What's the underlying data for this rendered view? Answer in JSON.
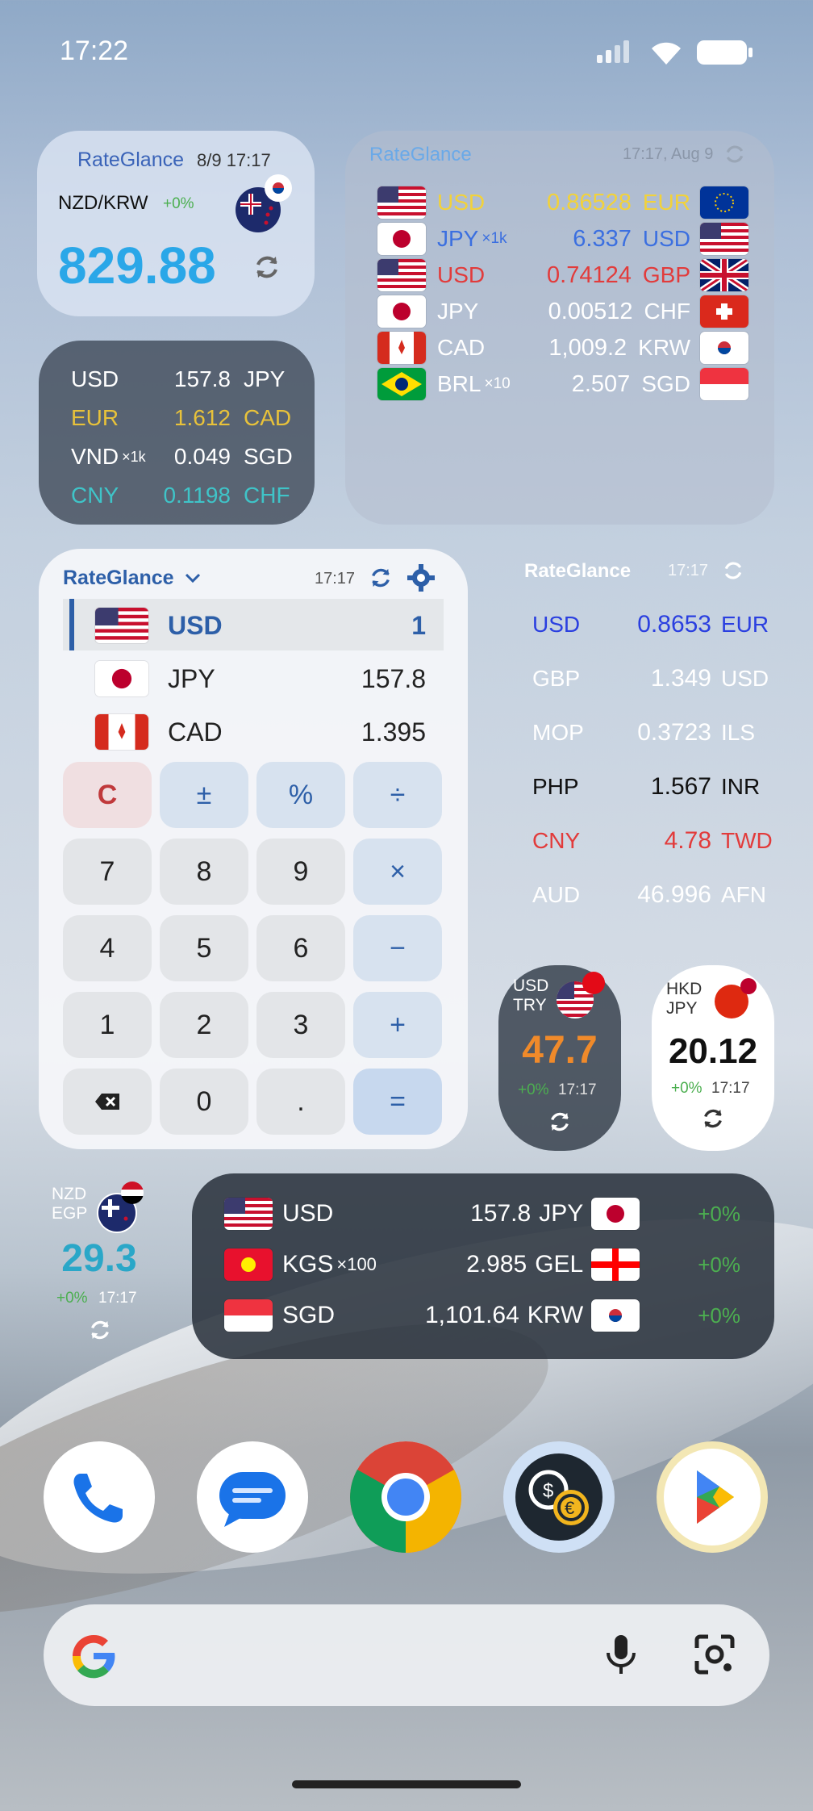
{
  "status": {
    "time": "17:22"
  },
  "w1": {
    "app": "RateGlance",
    "datetime": "8/9 17:17",
    "pair": "NZD/KRW",
    "change": "+0%",
    "rate": "829.88"
  },
  "w2": {
    "app": "RateGlance",
    "datetime": "17:17, Aug 9",
    "rows": [
      {
        "from": "USD",
        "mult": "",
        "rate": "0.86528",
        "to": "EUR",
        "color": "#f2d23a"
      },
      {
        "from": "JPY",
        "mult": "×1k",
        "rate": "6.337",
        "to": "USD",
        "color": "#3b6fe0"
      },
      {
        "from": "USD",
        "mult": "",
        "rate": "0.74124",
        "to": "GBP",
        "color": "#e23b3b"
      },
      {
        "from": "JPY",
        "mult": "",
        "rate": "0.00512",
        "to": "CHF",
        "color": "#ffffff"
      },
      {
        "from": "CAD",
        "mult": "",
        "rate": "1,009.2",
        "to": "KRW",
        "color": "#ffffff"
      },
      {
        "from": "BRL",
        "mult": "×10",
        "rate": "2.507",
        "to": "SGD",
        "color": "#ffffff"
      }
    ]
  },
  "w3": {
    "rows": [
      {
        "from": "USD",
        "mult": "",
        "rate": "157.8",
        "to": "JPY",
        "color": "#ffffff"
      },
      {
        "from": "EUR",
        "mult": "",
        "rate": "1.612",
        "to": "CAD",
        "color": "#e8c23a"
      },
      {
        "from": "VND",
        "mult": "×1k",
        "rate": "0.049",
        "to": "SGD",
        "color": "#ffffff"
      },
      {
        "from": "CNY",
        "mult": "",
        "rate": "0.1198",
        "to": "CHF",
        "color": "#3fc4c8"
      }
    ]
  },
  "calc": {
    "app": "RateGlance",
    "time": "17:17",
    "rows": [
      {
        "code": "USD",
        "value": "1"
      },
      {
        "code": "JPY",
        "value": "157.8"
      },
      {
        "code": "CAD",
        "value": "1.395"
      }
    ],
    "keys": [
      "C",
      "±",
      "%",
      "÷",
      "7",
      "8",
      "9",
      "×",
      "4",
      "5",
      "6",
      "−",
      "1",
      "2",
      "3",
      "+",
      "⌫",
      "0",
      ".",
      "="
    ]
  },
  "w5": {
    "app": "RateGlance",
    "time": "17:17",
    "rows": [
      {
        "from": "USD",
        "rate": "0.8653",
        "to": "EUR",
        "color": "#2a3fe0"
      },
      {
        "from": "GBP",
        "rate": "1.349",
        "to": "USD",
        "color": "#ffffff"
      },
      {
        "from": "MOP",
        "rate": "0.3723",
        "to": "ILS",
        "color": "#ffffff"
      },
      {
        "from": "PHP",
        "rate": "1.567",
        "to": "INR",
        "color": "#111111"
      },
      {
        "from": "CNY",
        "rate": "4.78",
        "to": "TWD",
        "color": "#e23b3b"
      },
      {
        "from": "AUD",
        "rate": "46.996",
        "to": "AFN",
        "color": "#ffffff"
      }
    ]
  },
  "w6": {
    "from": "USD",
    "to": "TRY",
    "rate": "47.7",
    "change": "+0%",
    "time": "17:17"
  },
  "w7": {
    "from": "HKD",
    "to": "JPY",
    "rate": "20.12",
    "change": "+0%",
    "time": "17:17"
  },
  "w8": {
    "from": "NZD",
    "to": "EGP",
    "rate": "29.3",
    "change": "+0%",
    "time": "17:17"
  },
  "w9": {
    "rows": [
      {
        "from": "USD",
        "mult": "",
        "rate": "157.8",
        "to": "JPY",
        "change": "+0%"
      },
      {
        "from": "KGS",
        "mult": "×100",
        "rate": "2.985",
        "to": "GEL",
        "change": "+0%"
      },
      {
        "from": "SGD",
        "mult": "",
        "rate": "1,101.64",
        "to": "KRW",
        "change": "+0%"
      }
    ]
  },
  "dock": [
    "phone-app",
    "messages-app",
    "chrome-app",
    "currency-converter-app",
    "play-store-app"
  ],
  "colors": {
    "rate_blue": "#2aa7e8",
    "orange": "#f08a2a",
    "green": "#4caf50",
    "calc_blue": "#2d5fa8"
  }
}
